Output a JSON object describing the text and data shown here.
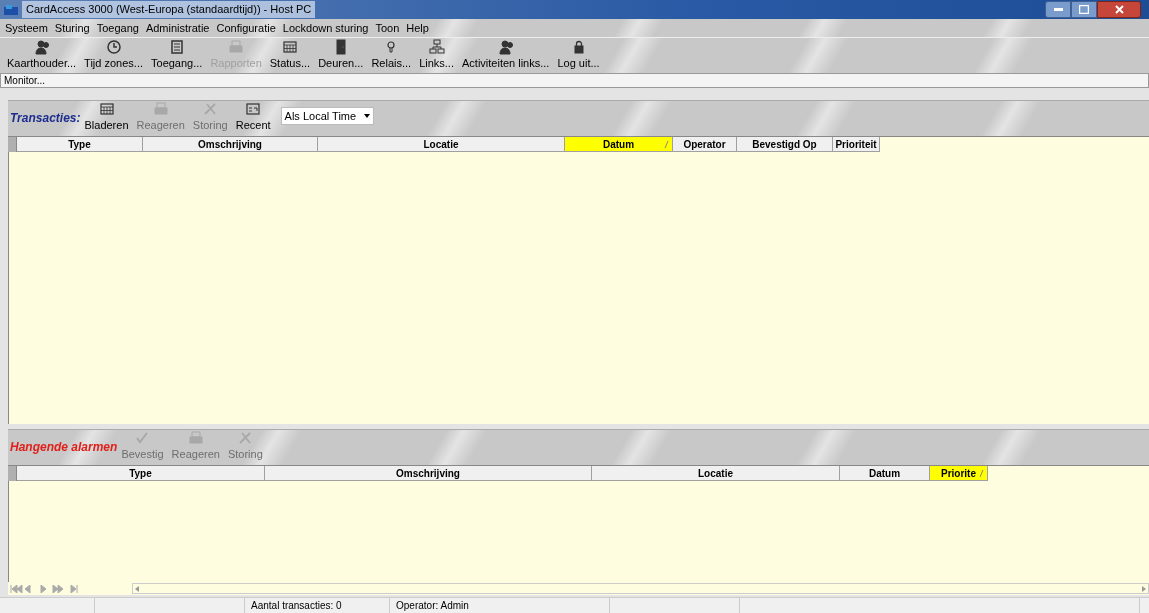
{
  "window": {
    "title": "CardAccess 3000 (West-Europa (standaardtijd))  -  Host PC"
  },
  "menu": [
    "Systeem",
    "Sturing",
    "Toegang",
    "Administratie",
    "Configuratie",
    "Lockdown sturing",
    "Toon",
    "Help"
  ],
  "toolbar": [
    {
      "label": "Kaarthouder...",
      "kind": "people",
      "disabled": false
    },
    {
      "label": "Tijd zones...",
      "kind": "clock",
      "disabled": false
    },
    {
      "label": "Toegang...",
      "kind": "key",
      "disabled": false
    },
    {
      "label": "Rapporten",
      "kind": "printer",
      "disabled": true
    },
    {
      "label": "Status...",
      "kind": "grid",
      "disabled": false
    },
    {
      "label": "Deuren...",
      "kind": "door",
      "disabled": false
    },
    {
      "label": "Relais...",
      "kind": "bulb",
      "disabled": false
    },
    {
      "label": "Links...",
      "kind": "links",
      "disabled": false
    },
    {
      "label": "Activiteiten links...",
      "kind": "people",
      "disabled": false
    },
    {
      "label": "Log uit...",
      "kind": "lock",
      "disabled": false
    }
  ],
  "monitor_field": {
    "value": "Monitor..."
  },
  "transactions": {
    "title": "Transacties:",
    "buttons": [
      {
        "label": "Bladeren",
        "kind": "grid",
        "disabled": false
      },
      {
        "label": "Reageren",
        "kind": "printer",
        "disabled": true
      },
      {
        "label": "Storing",
        "kind": "tools",
        "disabled": true
      },
      {
        "label": "Recent",
        "kind": "recent",
        "disabled": false
      }
    ],
    "time_select": {
      "value": "Als Local Time"
    },
    "columns": [
      {
        "label": "Type",
        "selected": false
      },
      {
        "label": "Omschrijving",
        "selected": false
      },
      {
        "label": "Locatie",
        "selected": false
      },
      {
        "label": "Datum",
        "selected": true
      },
      {
        "label": "Operator",
        "selected": false
      },
      {
        "label": "Bevestigd Op",
        "selected": false
      },
      {
        "label": "Prioriteit",
        "selected": false
      }
    ]
  },
  "alarms": {
    "title": "Hangende alarmen",
    "buttons": [
      {
        "label": "Bevestig",
        "kind": "check",
        "disabled": true
      },
      {
        "label": "Reageren",
        "kind": "printer",
        "disabled": true
      },
      {
        "label": "Storing",
        "kind": "tools",
        "disabled": true
      }
    ],
    "columns": [
      {
        "label": "Type",
        "selected": false
      },
      {
        "label": "Omschrijving",
        "selected": false
      },
      {
        "label": "Locatie",
        "selected": false
      },
      {
        "label": "Datum",
        "selected": false
      },
      {
        "label": "Priorite",
        "selected": true
      }
    ]
  },
  "status_bar": {
    "transactions": "Aantal transacties: 0",
    "operator": "Operator: Admin"
  }
}
